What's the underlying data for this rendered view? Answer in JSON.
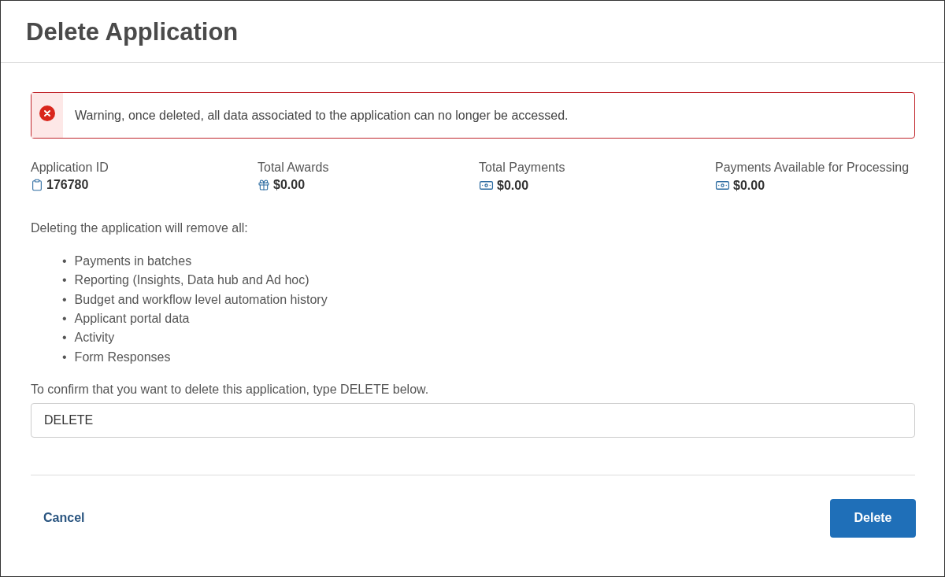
{
  "dialog": {
    "title": "Delete Application"
  },
  "warning": {
    "text": "Warning, once deleted, all data associated to the application can no longer be accessed."
  },
  "stats": [
    {
      "label": "Application ID",
      "value": "176780",
      "kind": "clipboard"
    },
    {
      "label": "Total Awards",
      "value": "$0.00",
      "kind": "gift"
    },
    {
      "label": "Total Payments",
      "value": "$0.00",
      "kind": "banknote"
    },
    {
      "label": "Payments Available for Processing",
      "value": "$0.00",
      "kind": "banknote"
    }
  ],
  "intro": "Deleting the application will remove all:",
  "items": [
    {
      "bullet": "•",
      "text": "Payments in batches"
    },
    {
      "bullet": "•",
      "text": "Reporting (Insights, Data hub and Ad hoc)"
    },
    {
      "bullet": "•",
      "text": "Budget and workflow level automation history"
    },
    {
      "bullet": "•",
      "text": "Applicant portal data"
    },
    {
      "bullet": "•",
      "text": "Activity"
    },
    {
      "bullet": "•",
      "text": "Form Responses"
    }
  ],
  "confirm": {
    "label": "To confirm that you want to delete this application, type DELETE below.",
    "value": "DELETE"
  },
  "buttons": {
    "cancel": "Cancel",
    "delete": "Delete"
  }
}
